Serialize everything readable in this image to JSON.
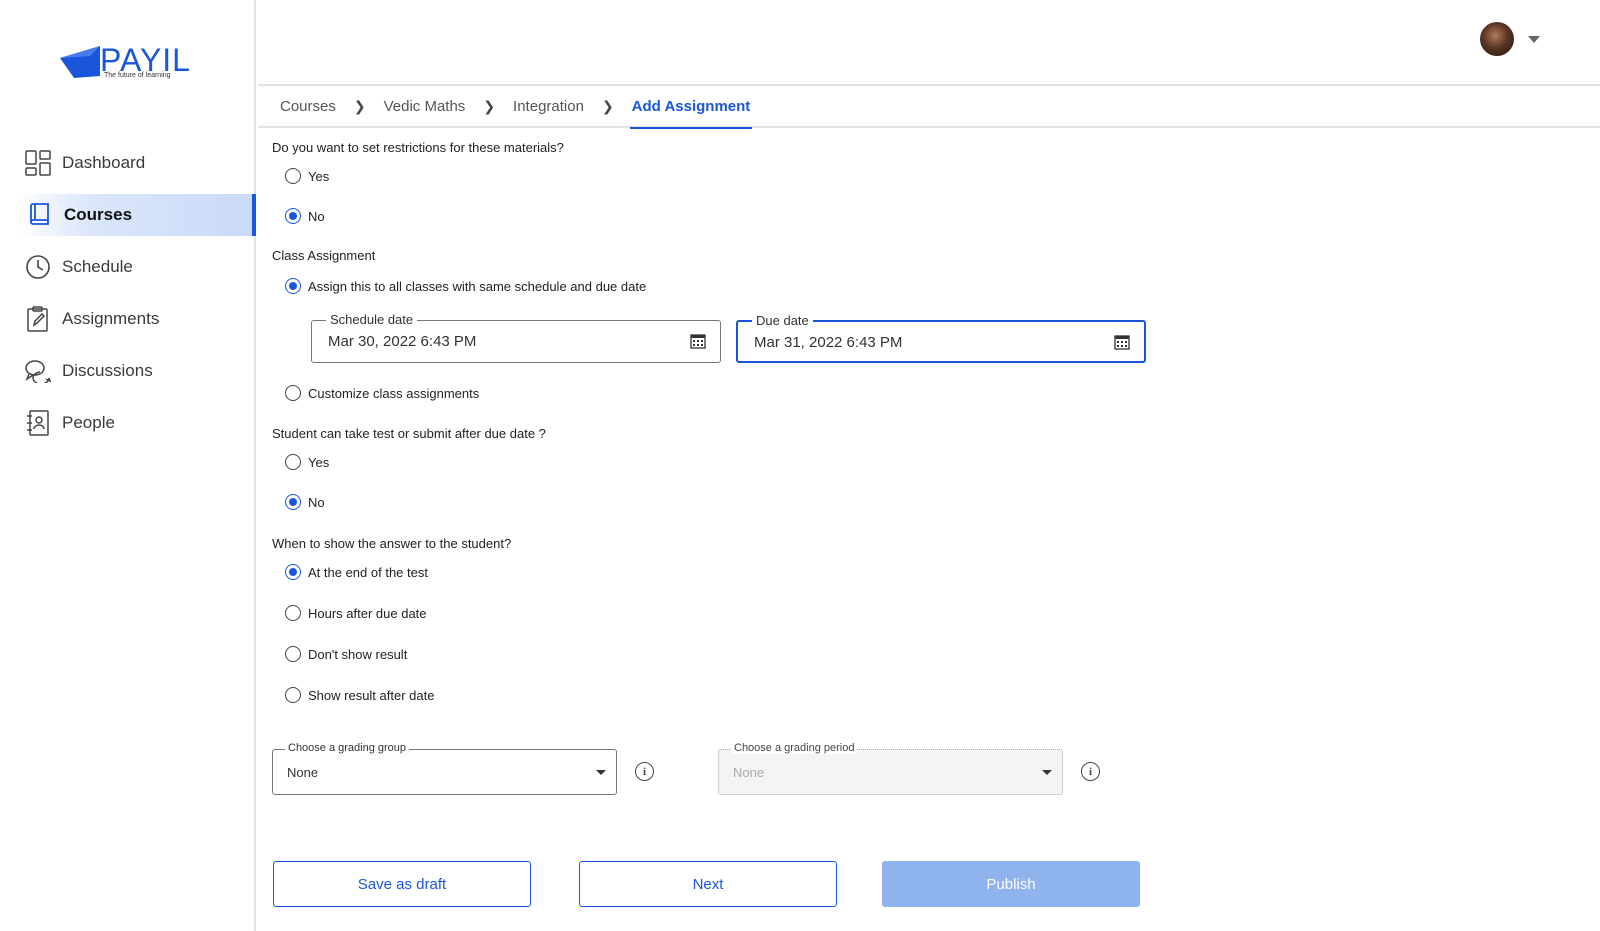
{
  "brand": {
    "name": "PAYIL",
    "tagline": "The future of learning"
  },
  "sidebar": {
    "items": [
      {
        "label": "Dashboard",
        "icon": "dashboard-icon",
        "active": false
      },
      {
        "label": "Courses",
        "icon": "book-icon",
        "active": true
      },
      {
        "label": "Schedule",
        "icon": "clock-icon",
        "active": false
      },
      {
        "label": "Assignments",
        "icon": "clipboard-pencil-icon",
        "active": false
      },
      {
        "label": "Discussions",
        "icon": "chat-bubbles-icon",
        "active": false
      },
      {
        "label": "People",
        "icon": "contact-book-icon",
        "active": false
      }
    ]
  },
  "header": {
    "avatar_icon": "user-avatar",
    "menu_icon": "caret-down-icon"
  },
  "breadcrumb": [
    "Courses",
    "Vedic Maths",
    "Integration",
    "Add Assignment"
  ],
  "form": {
    "restrictions": {
      "question": "Do you want to set restrictions for these materials?",
      "options": [
        "Yes",
        "No"
      ],
      "selected": "No"
    },
    "class_assignment": {
      "label": "Class Assignment",
      "option_all": "Assign this to all classes with same schedule and due date",
      "option_custom": "Customize class assignments",
      "selected": "all",
      "schedule_date": {
        "label": "Schedule date",
        "value": "Mar 30, 2022 6:43 PM"
      },
      "due_date": {
        "label": "Due date",
        "value": "Mar 31, 2022 6:43 PM"
      }
    },
    "late_submission": {
      "question": "Student can take test or submit after due date ?",
      "options": [
        "Yes",
        "No"
      ],
      "selected": "No"
    },
    "show_answer": {
      "question": "When to show the answer to the student?",
      "options": [
        "At the end of the test",
        "Hours after due date",
        "Don't show result",
        "Show result after date"
      ],
      "selected": "At the end of the test"
    },
    "grading_group": {
      "label": "Choose a grading group",
      "value": "None"
    },
    "grading_period": {
      "label": "Choose a grading period",
      "value": "None",
      "disabled": true
    }
  },
  "actions": {
    "save_draft": "Save as draft",
    "next": "Next",
    "publish": "Publish"
  },
  "colors": {
    "accent": "#1a56db",
    "publish_disabled": "#8fb3ec"
  }
}
